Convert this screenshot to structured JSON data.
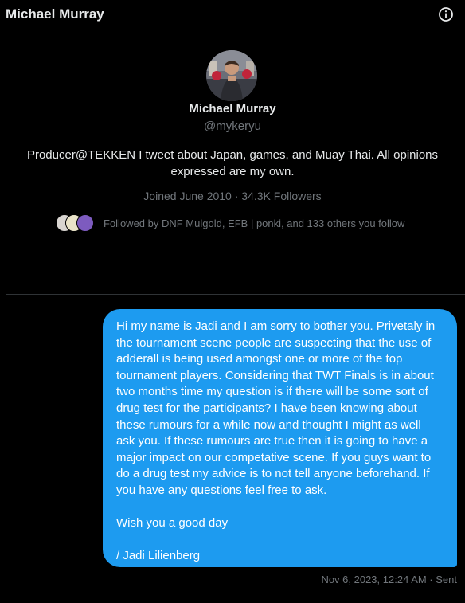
{
  "header": {
    "title": "Michael Murray",
    "info_icon": "info-circle-icon"
  },
  "profile": {
    "name": "Michael Murray",
    "handle": "@mykeryu",
    "bio": "Producer@TEKKEN I tweet about Japan, games, and Muay Thai. All opinions expressed are my own.",
    "joined": "Joined June 2010",
    "separator": "·",
    "followers": "34.3K Followers",
    "followed_by": "Followed by DNF Mulgold, EFB | ponki, and 133 others you follow"
  },
  "conversation": {
    "message": {
      "paragraph_1": "Hi my name is Jadi and I am sorry to bother you. Privetaly in the tournament scene people are suspecting that the use of adderall is being used amongst one or more of the top tournament players. Considering that TWT Finals is in about two months time my question is if there will be some sort of drug test for the participants? I have been knowing about these rumours for a while now and thought I might as well ask you. If these rumours are true then it is going to have a major impact on our competative scene. If you guys want to do a drug test my advice is to not tell anyone beforehand. If you have any questions feel free to ask.",
      "paragraph_2": "Wish you a good day",
      "paragraph_3": "/ Jadi Lilienberg"
    },
    "timestamp": "Nov 6, 2023, 12:24 AM · Sent"
  },
  "colors": {
    "background": "#000000",
    "bubble": "#1d9bf0",
    "text_primary": "#e7e9ea",
    "text_secondary": "#71767b",
    "divider": "#2f3336"
  }
}
